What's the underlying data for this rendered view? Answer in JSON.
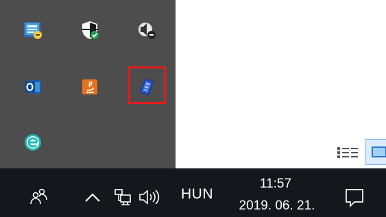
{
  "tray_overflow": {
    "icons": [
      {
        "name": "network-monitor-icon"
      },
      {
        "name": "windows-security-icon"
      },
      {
        "name": "speaker-volume-icon"
      },
      {
        "name": "outlook-icon"
      },
      {
        "name": "java-update-icon"
      },
      {
        "name": "usb-drive-icon",
        "highlighted": true
      },
      {
        "name": "eset-antivirus-icon"
      }
    ],
    "highlight_color": "#e41b1b",
    "background": "#4d4d4d"
  },
  "taskbar": {
    "background": "#14181c",
    "language": "HUN",
    "clock": {
      "time": "11:57",
      "date": "2019. 06. 21."
    }
  }
}
